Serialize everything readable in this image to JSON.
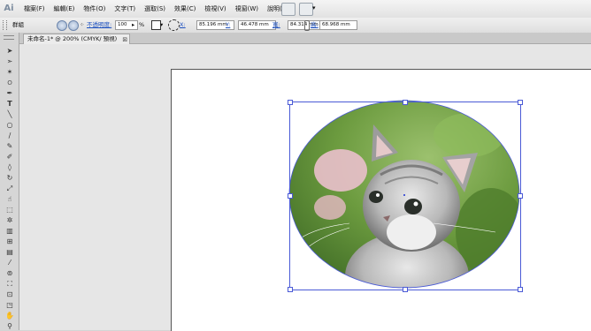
{
  "app": {
    "logo": "Ai"
  },
  "menubar": {
    "items": [
      "檔案(F)",
      "編輯(E)",
      "物件(O)",
      "文字(T)",
      "選取(S)",
      "效果(C)",
      "檢視(V)",
      "視窗(W)",
      "說明(H)"
    ],
    "icons": [
      "bridge-icon",
      "arrange-icon"
    ]
  },
  "control_bar": {
    "selection_label": "群組",
    "opacity_label": "不透明度:",
    "opacity_value": "100",
    "opacity_unit": "%",
    "x_label": "X:",
    "x_value": "85.196 mm",
    "y_label": "Y:",
    "y_value": "46.478 mm",
    "w_label": "寬:",
    "w_value": "84.314 mm",
    "h_label": "高:",
    "h_value": "68.968 mm"
  },
  "document": {
    "tab_title": "未命名-1* @ 200% (CMYK/ 預視)",
    "close_glyph": "⊠"
  },
  "tools": [
    "selection-tool-icon",
    "direct-selection-tool-icon",
    "magic-wand-tool-icon",
    "lasso-tool-icon",
    "pen-tool-icon",
    "type-tool-icon",
    "line-tool-icon",
    "ellipse-tool-icon",
    "paintbrush-tool-icon",
    "pencil-tool-icon",
    "blob-brush-tool-icon",
    "eraser-tool-icon",
    "rotate-tool-icon",
    "scale-tool-icon",
    "warp-tool-icon",
    "free-transform-tool-icon",
    "symbol-sprayer-tool-icon",
    "graph-tool-icon",
    "mesh-tool-icon",
    "gradient-tool-icon",
    "eyedropper-tool-icon",
    "blend-tool-icon",
    "live-paint-tool-icon",
    "artboard-tool-icon",
    "slice-tool-icon",
    "hand-tool-icon",
    "zoom-tool-icon"
  ],
  "colors": {
    "selection": "#4a5ad6",
    "link": "#1b4fbf",
    "artboard": "#ffffff"
  }
}
